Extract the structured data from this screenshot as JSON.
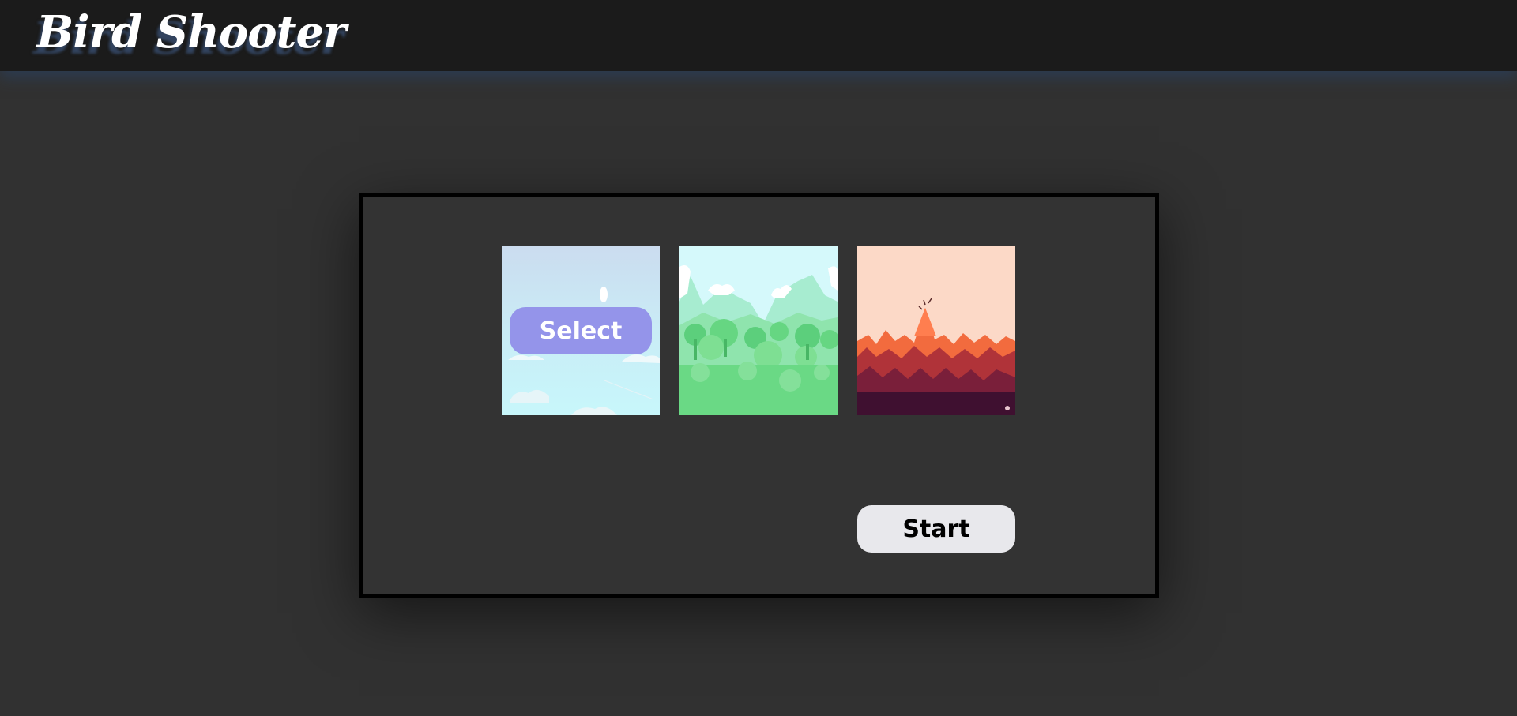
{
  "app": {
    "title": "Bird Shooter"
  },
  "level_select": {
    "backgrounds": [
      {
        "name": "sky",
        "selected": true
      },
      {
        "name": "forest",
        "selected": false
      },
      {
        "name": "volcano",
        "selected": false
      }
    ],
    "select_label": "Select",
    "start_label": "Start"
  },
  "colors": {
    "page_background": "#313131",
    "header_background": "#1b1b1b",
    "select_button": "#9494ea",
    "start_button": "#e8e8ec"
  }
}
